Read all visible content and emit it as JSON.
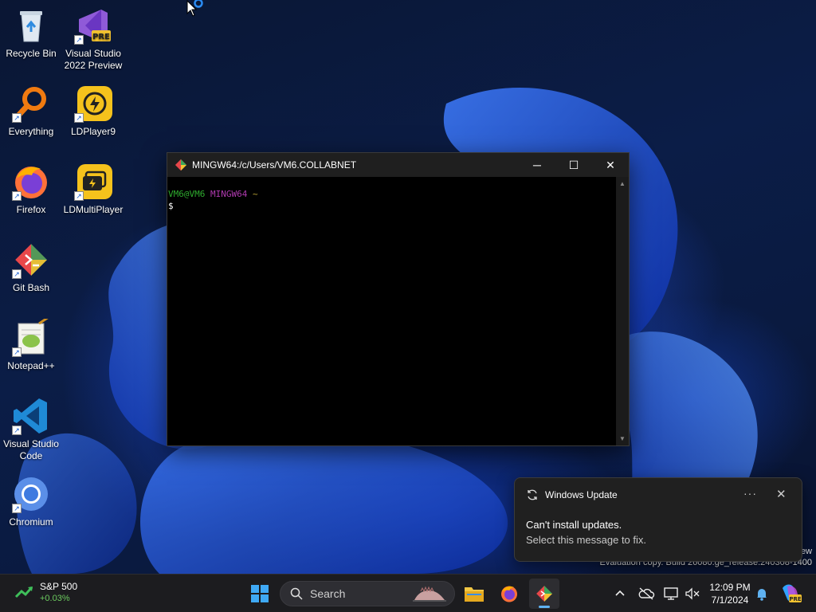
{
  "desktop": {
    "icons": [
      {
        "label": "Recycle Bin"
      },
      {
        "label": "Visual Studio 2022 Preview",
        "badge": "PRE"
      },
      {
        "label": "Everything"
      },
      {
        "label": "LDPlayer9"
      },
      {
        "label": "Firefox"
      },
      {
        "label": "LDMultiPlayer"
      },
      {
        "label": "Git Bash"
      },
      {
        "label": "Notepad++"
      },
      {
        "label": "Visual Studio Code"
      },
      {
        "label": "Chromium"
      }
    ]
  },
  "terminal": {
    "title": "MINGW64:/c/Users/VM6.COLLABNET",
    "prompt_user": "VM6@VM6",
    "prompt_host": "MINGW64",
    "prompt_path": "~",
    "prompt_symbol": "$",
    "minimize_glyph": "─",
    "maximize_glyph": "☐",
    "close_glyph": "✕"
  },
  "notification": {
    "app": "Windows Update",
    "title": "Can't install updates.",
    "body": "Select this message to fix.",
    "more_glyph": "···",
    "close_glyph": "✕"
  },
  "watermark": {
    "line1": "ew",
    "line2": "Evaluation copy. Build 26080.ge_release.240308-1400"
  },
  "taskbar": {
    "widget": {
      "name": "S&P 500",
      "value": "+0.03%"
    },
    "search_label": "Search",
    "clock": {
      "time": "12:09 PM",
      "date": "7/1/2024"
    },
    "copilot_badge": "PRE"
  },
  "colors": {
    "accent": "#5fb2f2",
    "positive": "#6ccb5f",
    "prompt_user": "#2eaa2e",
    "prompt_host": "#b03ab0",
    "prompt_path": "#b8a235"
  }
}
